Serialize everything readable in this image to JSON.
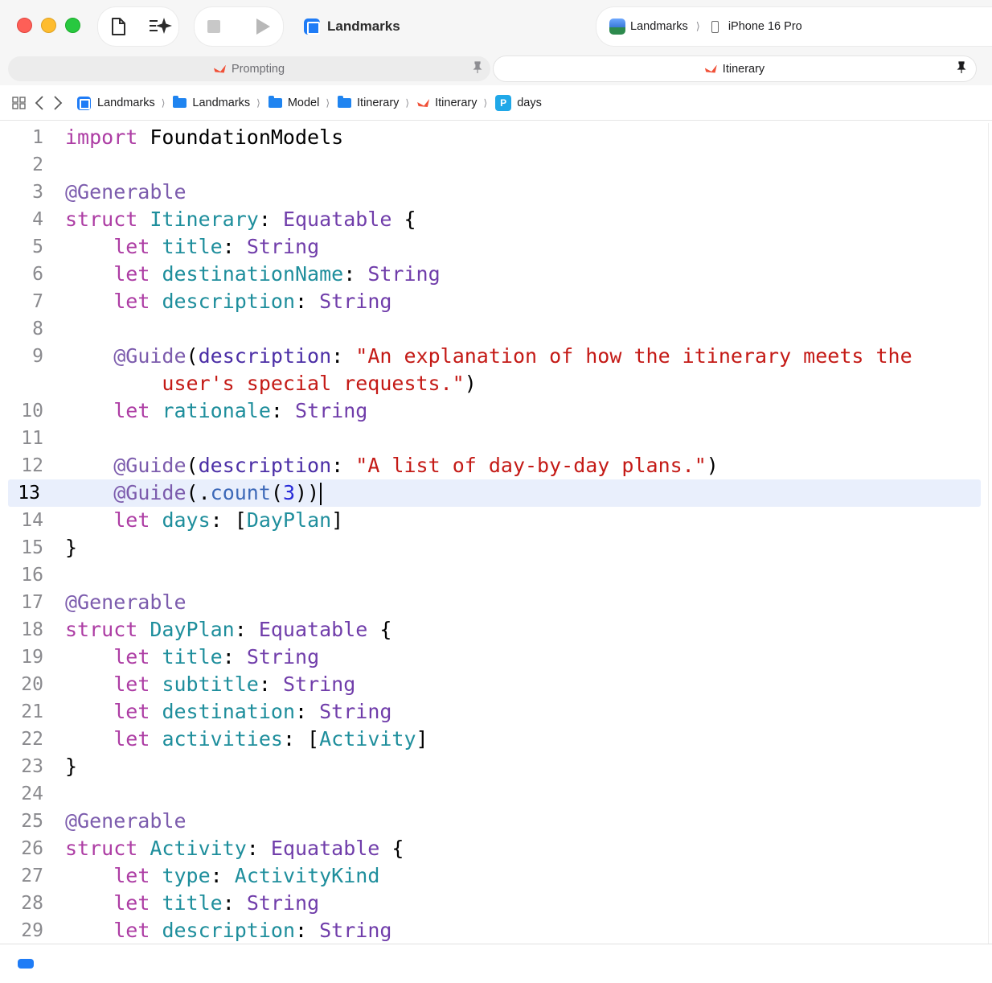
{
  "toolbar": {
    "app_title": "Landmarks",
    "scheme_app": "Landmarks",
    "destination": "iPhone 16 Pro",
    "icons": [
      "document-icon",
      "coding-assistant-icon",
      "stop-icon",
      "run-icon"
    ]
  },
  "tabs": [
    {
      "label": "Prompting",
      "active": false
    },
    {
      "label": "Itinerary",
      "active": true
    }
  ],
  "jumpbar": {
    "crumbs": [
      "Landmarks",
      "Landmarks",
      "Model",
      "Itinerary",
      "Itinerary",
      "days"
    ]
  },
  "editor": {
    "current_line": 13,
    "lines": [
      {
        "n": "1",
        "tokens": [
          [
            "kw",
            "import"
          ],
          [
            "",
            "FoundationModels"
          ]
        ]
      },
      {
        "n": "2",
        "tokens": []
      },
      {
        "n": "3",
        "tokens": [
          [
            "at",
            "@Generable"
          ]
        ]
      },
      {
        "n": "4",
        "tokens": [
          [
            "kw",
            "struct"
          ],
          [
            "ty",
            "Itinerary"
          ],
          [
            "",
            ": "
          ],
          [
            "tyd",
            "Equatable"
          ],
          [
            "",
            " {"
          ]
        ]
      },
      {
        "n": "5",
        "tokens": [
          [
            "",
            "    "
          ],
          [
            "kw",
            "let"
          ],
          [
            "",
            " "
          ],
          [
            "ty",
            "title"
          ],
          [
            "",
            ": "
          ],
          [
            "tyd",
            "String"
          ]
        ]
      },
      {
        "n": "6",
        "tokens": [
          [
            "",
            "    "
          ],
          [
            "kw",
            "let"
          ],
          [
            "",
            " "
          ],
          [
            "ty",
            "destinationName"
          ],
          [
            "",
            ": "
          ],
          [
            "tyd",
            "String"
          ]
        ]
      },
      {
        "n": "7",
        "tokens": [
          [
            "",
            "    "
          ],
          [
            "kw",
            "let"
          ],
          [
            "",
            " "
          ],
          [
            "ty",
            "description"
          ],
          [
            "",
            ": "
          ],
          [
            "tyd",
            "String"
          ]
        ]
      },
      {
        "n": "8",
        "tokens": []
      },
      {
        "n": "9",
        "tokens": [
          [
            "",
            "    "
          ],
          [
            "at",
            "@Guide"
          ],
          [
            "",
            "("
          ],
          [
            "pr",
            "description"
          ],
          [
            "",
            ": "
          ],
          [
            "str",
            "\"An explanation of how the itinerary meets the"
          ]
        ]
      },
      {
        "n": "",
        "tokens": [
          [
            "",
            "        "
          ],
          [
            "str",
            "user's special requests.\""
          ],
          [
            "",
            ")"
          ]
        ]
      },
      {
        "n": "10",
        "tokens": [
          [
            "",
            "    "
          ],
          [
            "kw",
            "let"
          ],
          [
            "",
            " "
          ],
          [
            "ty",
            "rationale"
          ],
          [
            "",
            ": "
          ],
          [
            "tyd",
            "String"
          ]
        ]
      },
      {
        "n": "11",
        "tokens": []
      },
      {
        "n": "12",
        "tokens": [
          [
            "",
            "    "
          ],
          [
            "at",
            "@Guide"
          ],
          [
            "",
            "("
          ],
          [
            "pr",
            "description"
          ],
          [
            "",
            ": "
          ],
          [
            "str",
            "\"A list of day-by-day plans.\""
          ],
          [
            "",
            ")"
          ]
        ]
      },
      {
        "n": "13",
        "tokens": [
          [
            "",
            "    "
          ],
          [
            "at",
            "@Guide"
          ],
          [
            "",
            "(."
          ],
          [
            "fn",
            "count"
          ],
          [
            "",
            "("
          ],
          [
            "num",
            "3"
          ],
          [
            "",
            "))"
          ]
        ]
      },
      {
        "n": "14",
        "tokens": [
          [
            "",
            "    "
          ],
          [
            "kw",
            "let"
          ],
          [
            "",
            " "
          ],
          [
            "ty",
            "days"
          ],
          [
            "",
            ": ["
          ],
          [
            "ty",
            "DayPlan"
          ],
          [
            "",
            "]"
          ]
        ]
      },
      {
        "n": "15",
        "tokens": [
          [
            "",
            "}"
          ]
        ]
      },
      {
        "n": "16",
        "tokens": []
      },
      {
        "n": "17",
        "tokens": [
          [
            "at",
            "@Generable"
          ]
        ]
      },
      {
        "n": "18",
        "tokens": [
          [
            "kw",
            "struct"
          ],
          [
            "ty",
            "DayPlan"
          ],
          [
            "",
            ": "
          ],
          [
            "tyd",
            "Equatable"
          ],
          [
            "",
            " {"
          ]
        ]
      },
      {
        "n": "19",
        "tokens": [
          [
            "",
            "    "
          ],
          [
            "kw",
            "let"
          ],
          [
            "",
            " "
          ],
          [
            "ty",
            "title"
          ],
          [
            "",
            ": "
          ],
          [
            "tyd",
            "String"
          ]
        ]
      },
      {
        "n": "20",
        "tokens": [
          [
            "",
            "    "
          ],
          [
            "kw",
            "let"
          ],
          [
            "",
            " "
          ],
          [
            "ty",
            "subtitle"
          ],
          [
            "",
            ": "
          ],
          [
            "tyd",
            "String"
          ]
        ]
      },
      {
        "n": "21",
        "tokens": [
          [
            "",
            "    "
          ],
          [
            "kw",
            "let"
          ],
          [
            "",
            " "
          ],
          [
            "ty",
            "destination"
          ],
          [
            "",
            ": "
          ],
          [
            "tyd",
            "String"
          ]
        ]
      },
      {
        "n": "22",
        "tokens": [
          [
            "",
            "    "
          ],
          [
            "kw",
            "let"
          ],
          [
            "",
            " "
          ],
          [
            "ty",
            "activities"
          ],
          [
            "",
            ": ["
          ],
          [
            "ty",
            "Activity"
          ],
          [
            "",
            "]"
          ]
        ]
      },
      {
        "n": "23",
        "tokens": [
          [
            "",
            "}"
          ]
        ]
      },
      {
        "n": "24",
        "tokens": []
      },
      {
        "n": "25",
        "tokens": [
          [
            "at",
            "@Generable"
          ]
        ]
      },
      {
        "n": "26",
        "tokens": [
          [
            "kw",
            "struct"
          ],
          [
            "ty",
            "Activity"
          ],
          [
            "",
            ": "
          ],
          [
            "tyd",
            "Equatable"
          ],
          [
            "",
            " {"
          ]
        ]
      },
      {
        "n": "27",
        "tokens": [
          [
            "",
            "    "
          ],
          [
            "kw",
            "let"
          ],
          [
            "",
            " "
          ],
          [
            "ty",
            "type"
          ],
          [
            "",
            ": "
          ],
          [
            "ty",
            "ActivityKind"
          ]
        ]
      },
      {
        "n": "28",
        "tokens": [
          [
            "",
            "    "
          ],
          [
            "kw",
            "let"
          ],
          [
            "",
            " "
          ],
          [
            "ty",
            "title"
          ],
          [
            "",
            ": "
          ],
          [
            "tyd",
            "String"
          ]
        ]
      },
      {
        "n": "29",
        "tokens": [
          [
            "",
            "    "
          ],
          [
            "kw",
            "let"
          ],
          [
            "",
            " "
          ],
          [
            "ty",
            "description"
          ],
          [
            "",
            ": "
          ],
          [
            "tyd",
            "String"
          ]
        ]
      }
    ]
  },
  "colors": {
    "keyword": "#ad3da4",
    "type": "#1e8e9c",
    "protocol": "#703daa",
    "attribute": "#7c5cad",
    "string": "#c41a16",
    "current_line": "#e9effc",
    "accent": "#1f7cf6"
  }
}
